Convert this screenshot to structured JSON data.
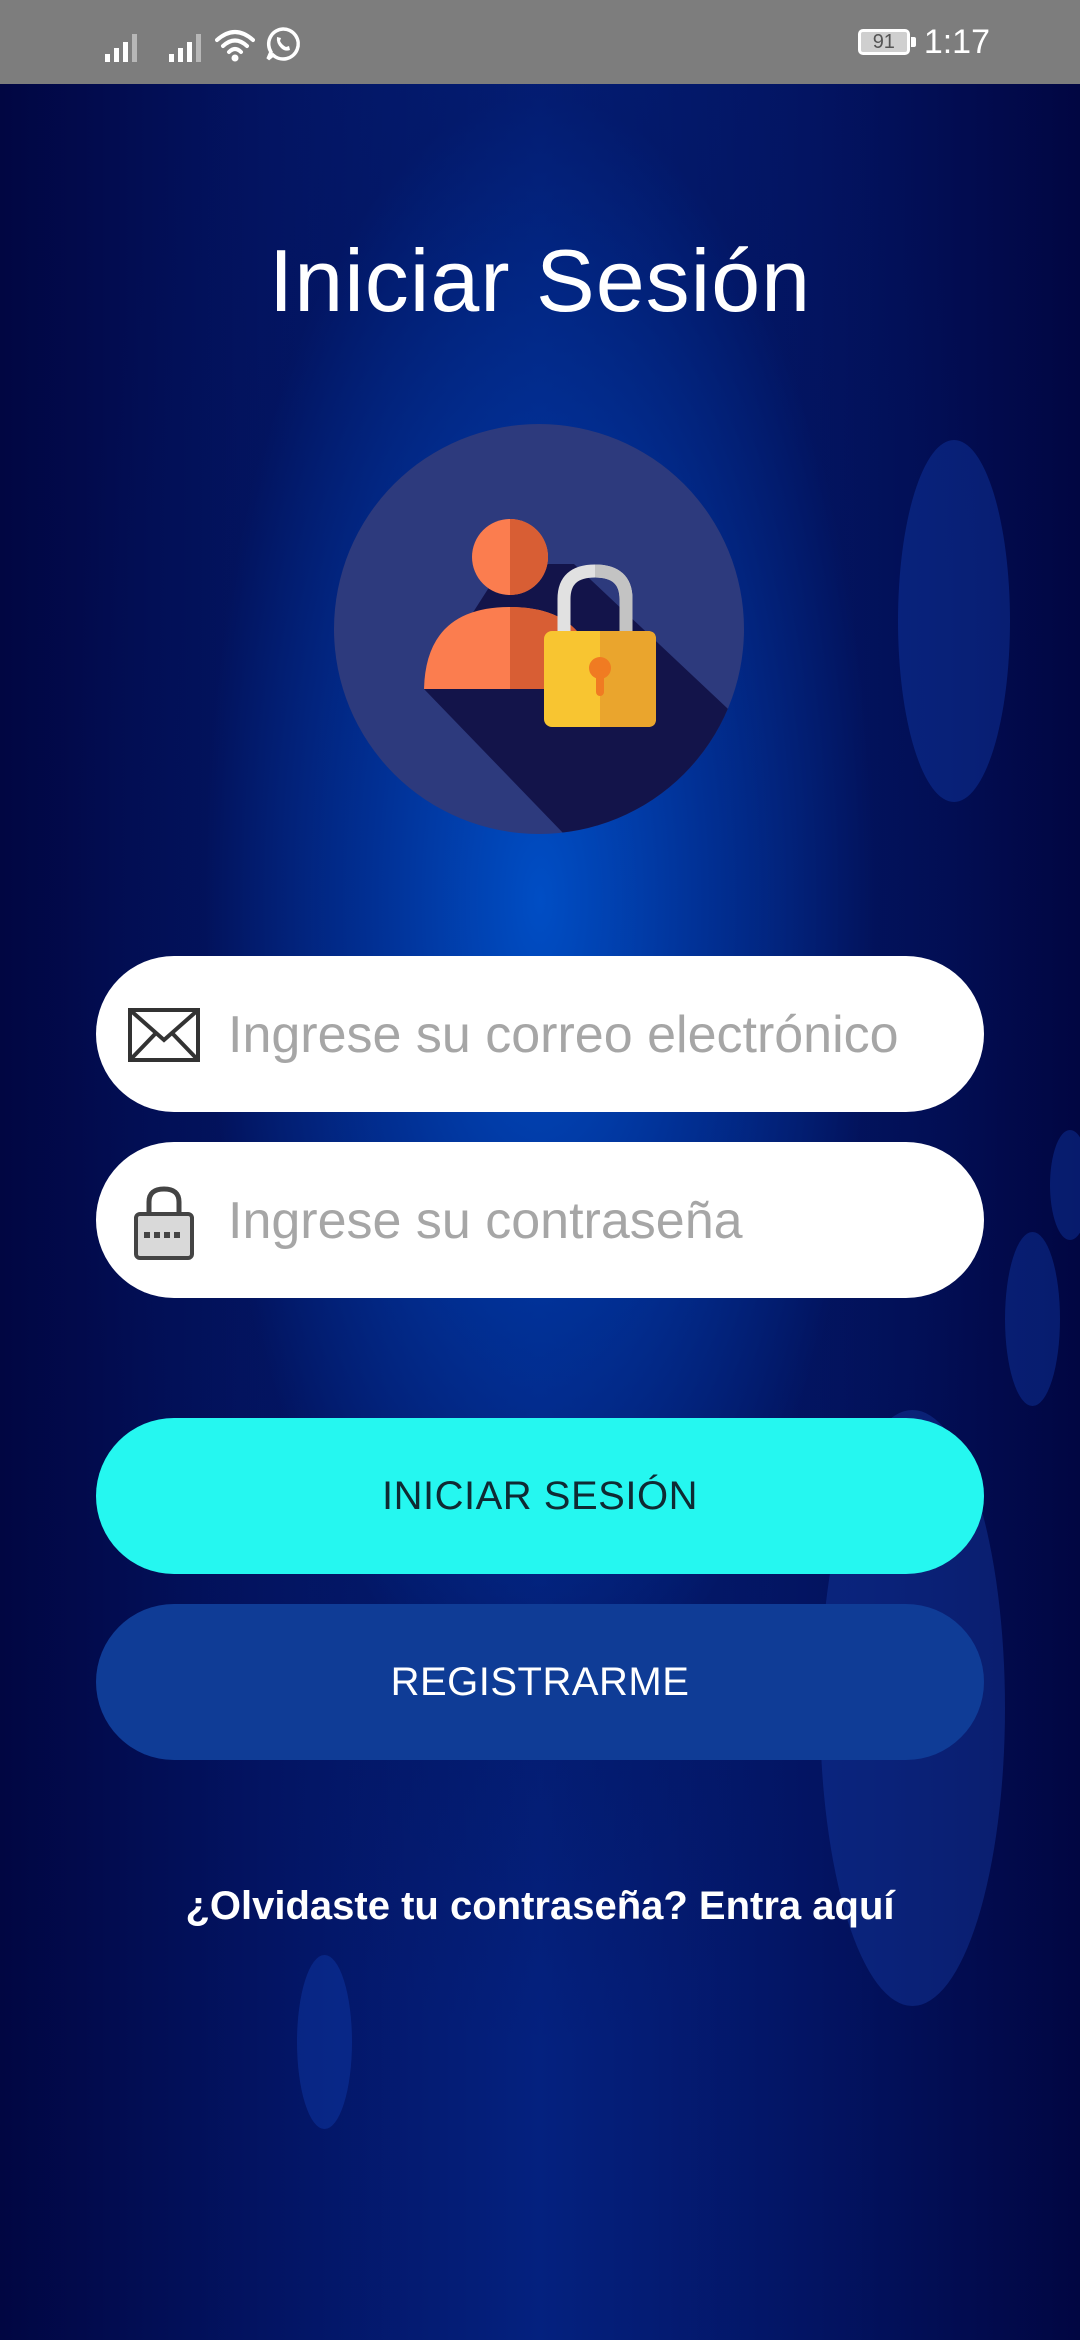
{
  "status_bar": {
    "battery": "91",
    "time": "1:17"
  },
  "login": {
    "title": "Iniciar Sesión",
    "email_placeholder": "Ingrese su correo electrónico",
    "password_placeholder": "Ingrese su contraseña",
    "login_button": "INICIAR SESIÓN",
    "register_button": "REGISTRARME",
    "forgot_link": "¿Olvidaste tu contraseña? Entra aquí"
  },
  "colors": {
    "primary_button": "#25f7f0",
    "secondary_button": "#0f3c96",
    "avatar_person": "#fb7d4f",
    "lock_body": "#f8c531"
  },
  "icons": [
    "signal-icon",
    "wifi-icon",
    "whatsapp-icon",
    "battery-icon",
    "user-lock-icon",
    "envelope-icon",
    "padlock-icon"
  ]
}
